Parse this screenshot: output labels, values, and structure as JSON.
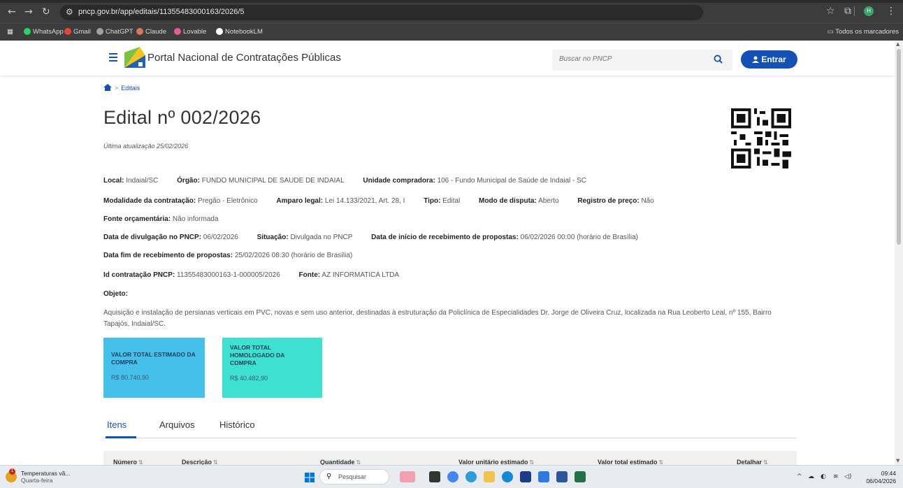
{
  "browser": {
    "url": "pncp.gov.br/app/editais/11355483000163/2026/5",
    "profile_initial": "H",
    "bookmarks": [
      {
        "label": "WhatsApp",
        "color": "#25d366"
      },
      {
        "label": "Gmail",
        "color": "#ea4335"
      },
      {
        "label": "ChatGPT",
        "color": "#a0a0a0"
      },
      {
        "label": "Claude",
        "color": "#d97757"
      },
      {
        "label": "Lovable",
        "color": "#e85a9b"
      },
      {
        "label": "NotebookLM",
        "color": "#ffffff"
      }
    ],
    "all_bookmarks": "Todos os marcadores"
  },
  "header": {
    "title": "Portal Nacional de Contratações Públicas",
    "search_placeholder": "Buscar no PNCP",
    "login_label": "Entrar"
  },
  "breadcrumb": {
    "current": "Editais"
  },
  "edital": {
    "title": "Edital nº 002/2026",
    "updated": "Última atualização 25/02/2026",
    "local_label": "Local:",
    "local": "Indaial/SC",
    "orgao_label": "Órgão:",
    "orgao": "FUNDO MUNICIPAL DE SAUDE DE INDAIAL",
    "unidade_label": "Unidade compradora:",
    "unidade": "106 - Fundo Municipal de Saúde de Indaial - SC",
    "modalidade_label": "Modalidade da contratação:",
    "modalidade": "Pregão - Eletrônico",
    "amparo_label": "Amparo legal:",
    "amparo": "Lei 14.133/2021, Art. 28, I",
    "tipo_label": "Tipo:",
    "tipo": "Edital",
    "modo_label": "Modo de disputa:",
    "modo": "Aberto",
    "registro_label": "Registro de preço:",
    "registro": "Não",
    "fonte_orc_label": "Fonte orçamentária:",
    "fonte_orc": "Não informada",
    "divulgacao_label": "Data de divulgação no PNCP:",
    "divulgacao": "06/02/2026",
    "situacao_label": "Situação:",
    "situacao": "Divulgada no PNCP",
    "inicio_label": "Data de início de recebimento de propostas:",
    "inicio": "06/02/2026 00:00 (horário de Brasília)",
    "fim_label": "Data fim de recebimento de propostas:",
    "fim": "25/02/2026 08:30 (horário de Brasília)",
    "id_label": "Id contratação PNCP:",
    "id": "11355483000163-1-000005/2026",
    "fonte_label": "Fonte:",
    "fonte": "AZ INFORMATICA LTDA",
    "objeto_label": "Objeto:",
    "objeto": "Aquisição e instalação de persianas verticais em PVC, novas e sem uso anterior, destinadas à estruturação da Policlínica de Especialidades Dr. Jorge de Oliveira Cruz, localizada na Rua Leoberto Leal, nº 155, Bairro Tapajós, Indaial/SC."
  },
  "cards": {
    "estimado_label": "VALOR TOTAL ESTIMADO DA COMPRA",
    "estimado_value": "R$ 80.740,90",
    "homologado_label": "VALOR TOTAL HOMOLOGADO DA COMPRA",
    "homologado_value": "R$ 40.482,90"
  },
  "tabs": [
    "Itens",
    "Arquivos",
    "Histórico"
  ],
  "table": {
    "columns": [
      "Número",
      "Descrição",
      "Quantidade",
      "Valor unitário estimado",
      "Valor total estimado",
      "Detalhar"
    ]
  },
  "taskbar": {
    "weather_title": "Temperaturas vã...",
    "weather_sub": "Quarta-feira",
    "weather_badge": "1",
    "search_label": "Pesquisar",
    "time": "09:44",
    "date": "06/04/2026"
  },
  "colors": {
    "primary": "#1351b4",
    "card_estimado": "#45c0ea",
    "card_homologado": "#3ee0cf"
  }
}
